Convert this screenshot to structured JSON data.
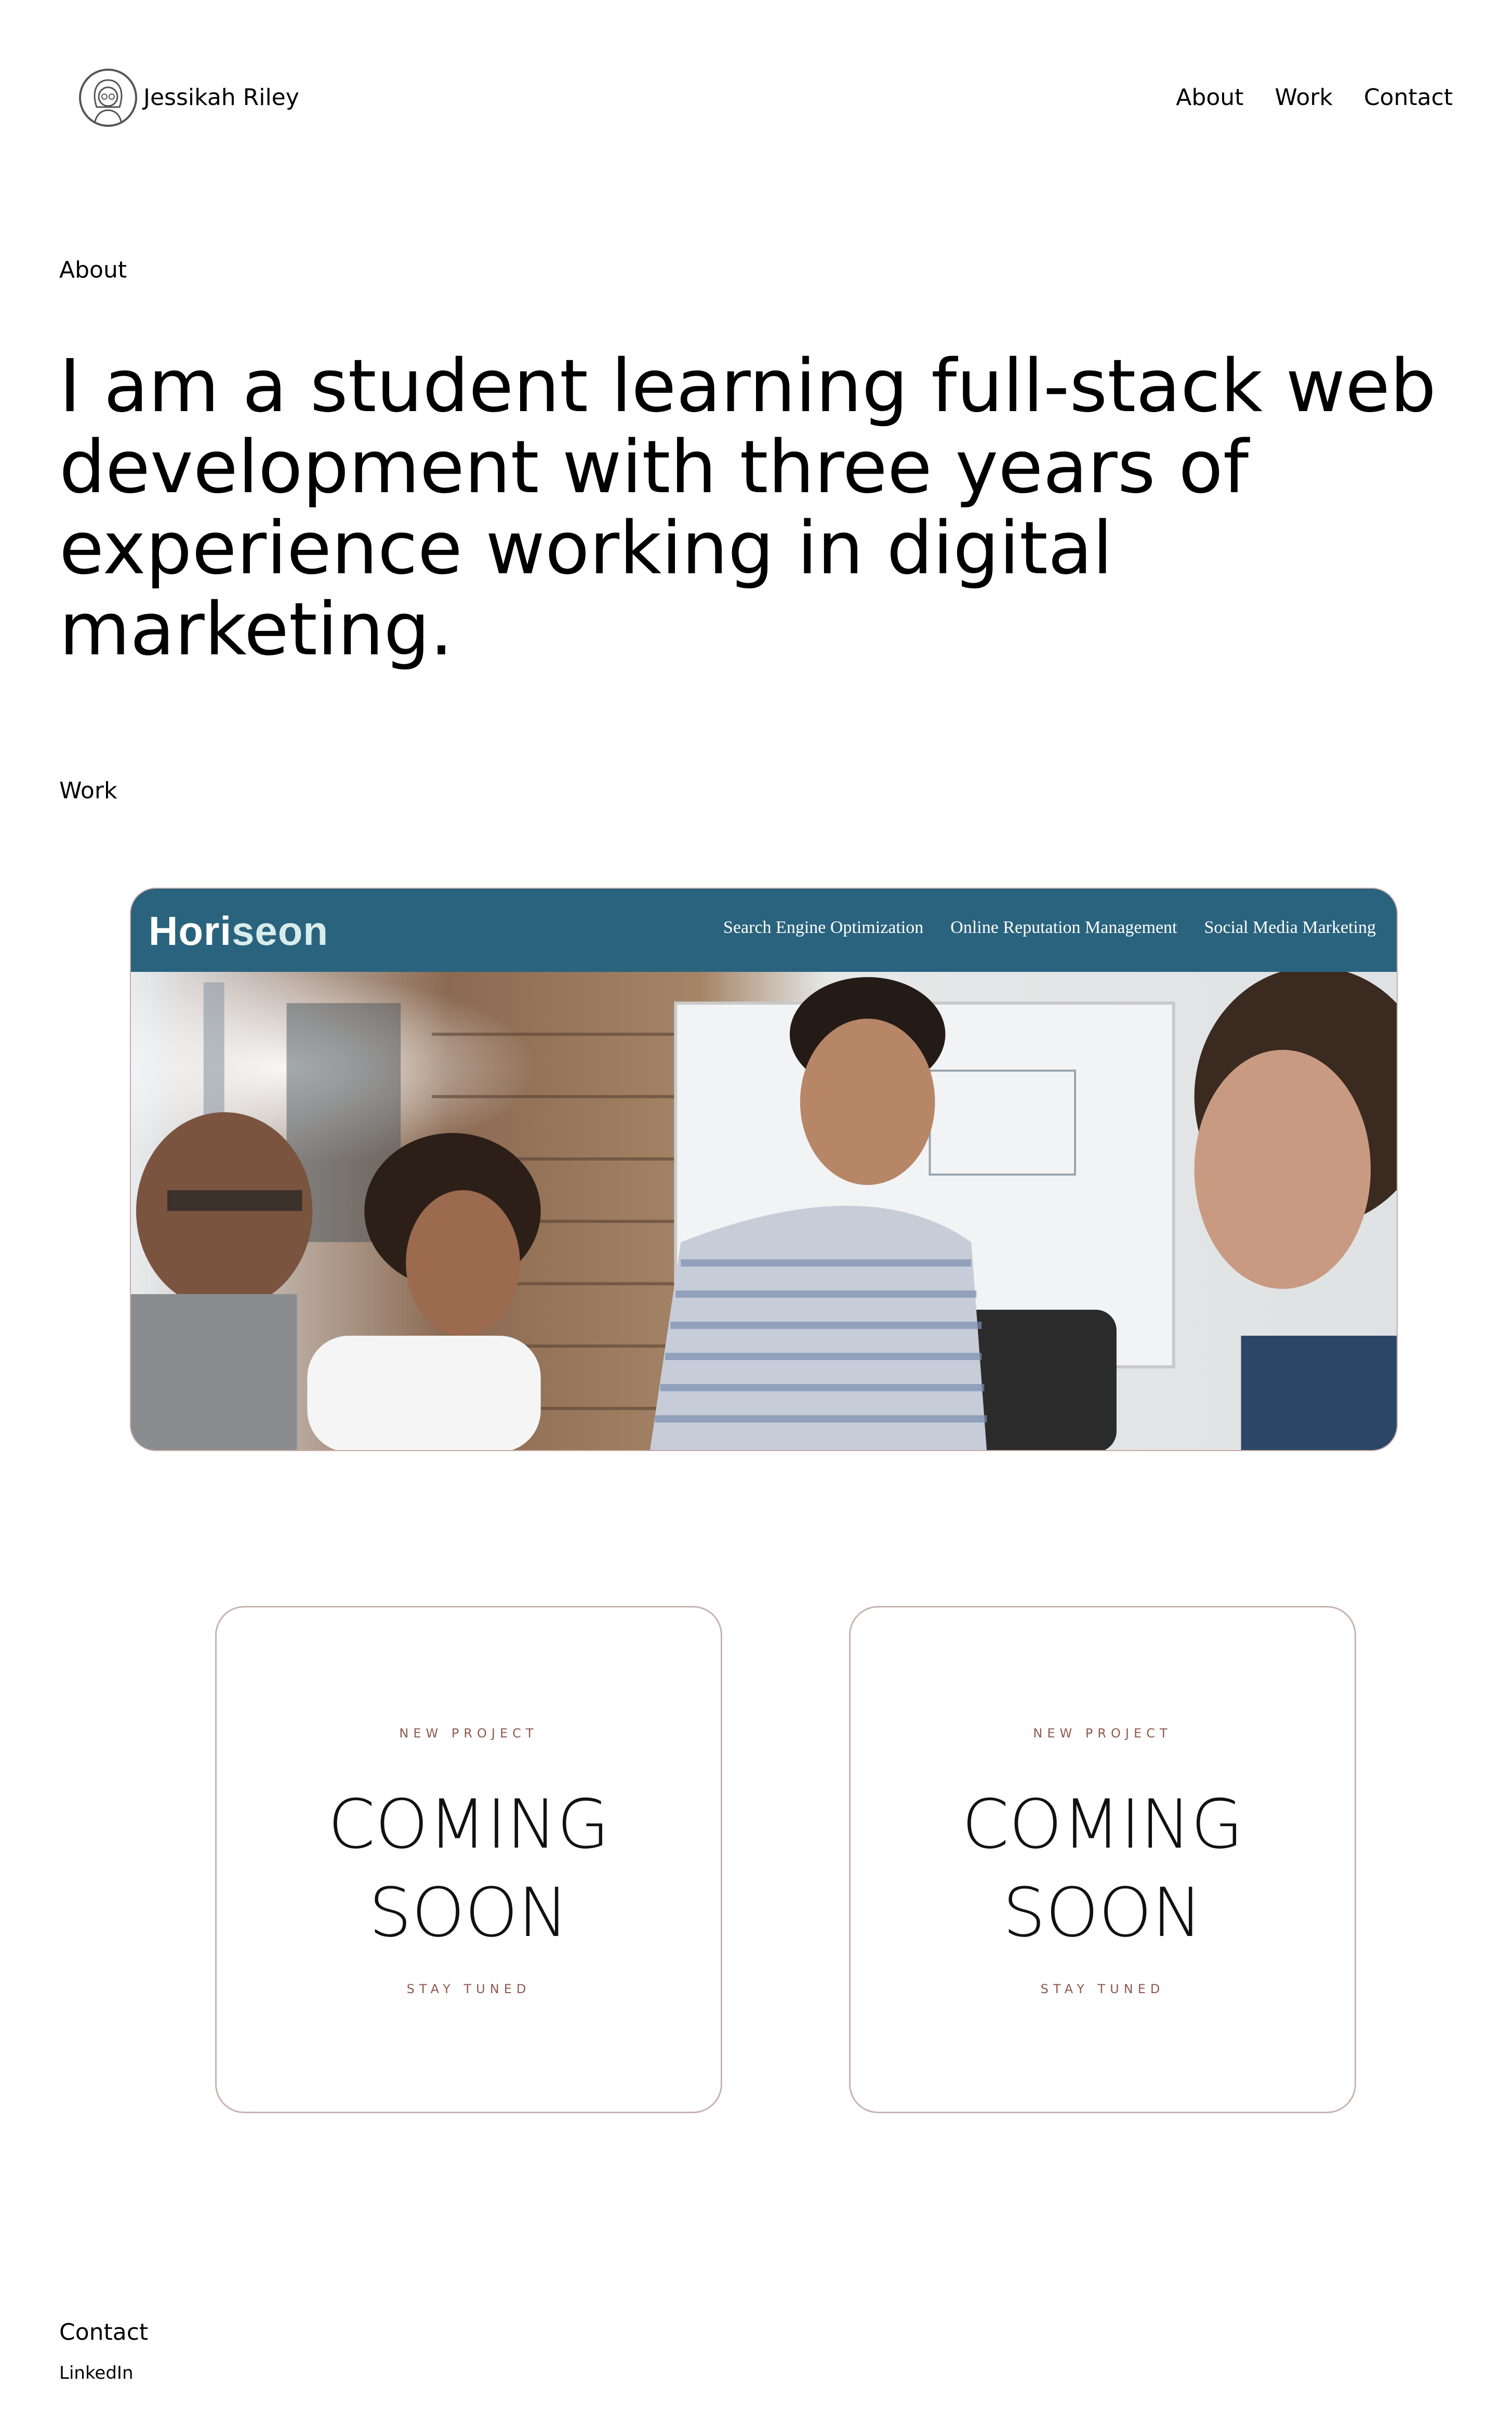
{
  "header": {
    "site_name": "Jessikah Riley",
    "avatar_icon": "woman-portrait-icon",
    "nav": [
      {
        "label": "About"
      },
      {
        "label": "Work"
      },
      {
        "label": "Contact"
      }
    ]
  },
  "about": {
    "label": "About",
    "text": "I am a student learning full-stack web development with three years of experience working in digital marketing."
  },
  "work": {
    "label": "Work",
    "featured": {
      "brand_main": "Hori",
      "brand_accent": "seon",
      "nav": [
        "Search Engine Optimization",
        "Online Reputation Management",
        "Social Media Marketing"
      ],
      "header_color": "#2a637e"
    },
    "cards": [
      {
        "kicker": "NEW PROJECT",
        "line1": "COMING",
        "line2": "SOON",
        "sub": "STAY TUNED"
      },
      {
        "kicker": "NEW PROJECT",
        "line1": "COMING",
        "line2": "SOON",
        "sub": "STAY TUNED"
      }
    ]
  },
  "contact": {
    "label": "Contact",
    "link": "LinkedIn"
  }
}
